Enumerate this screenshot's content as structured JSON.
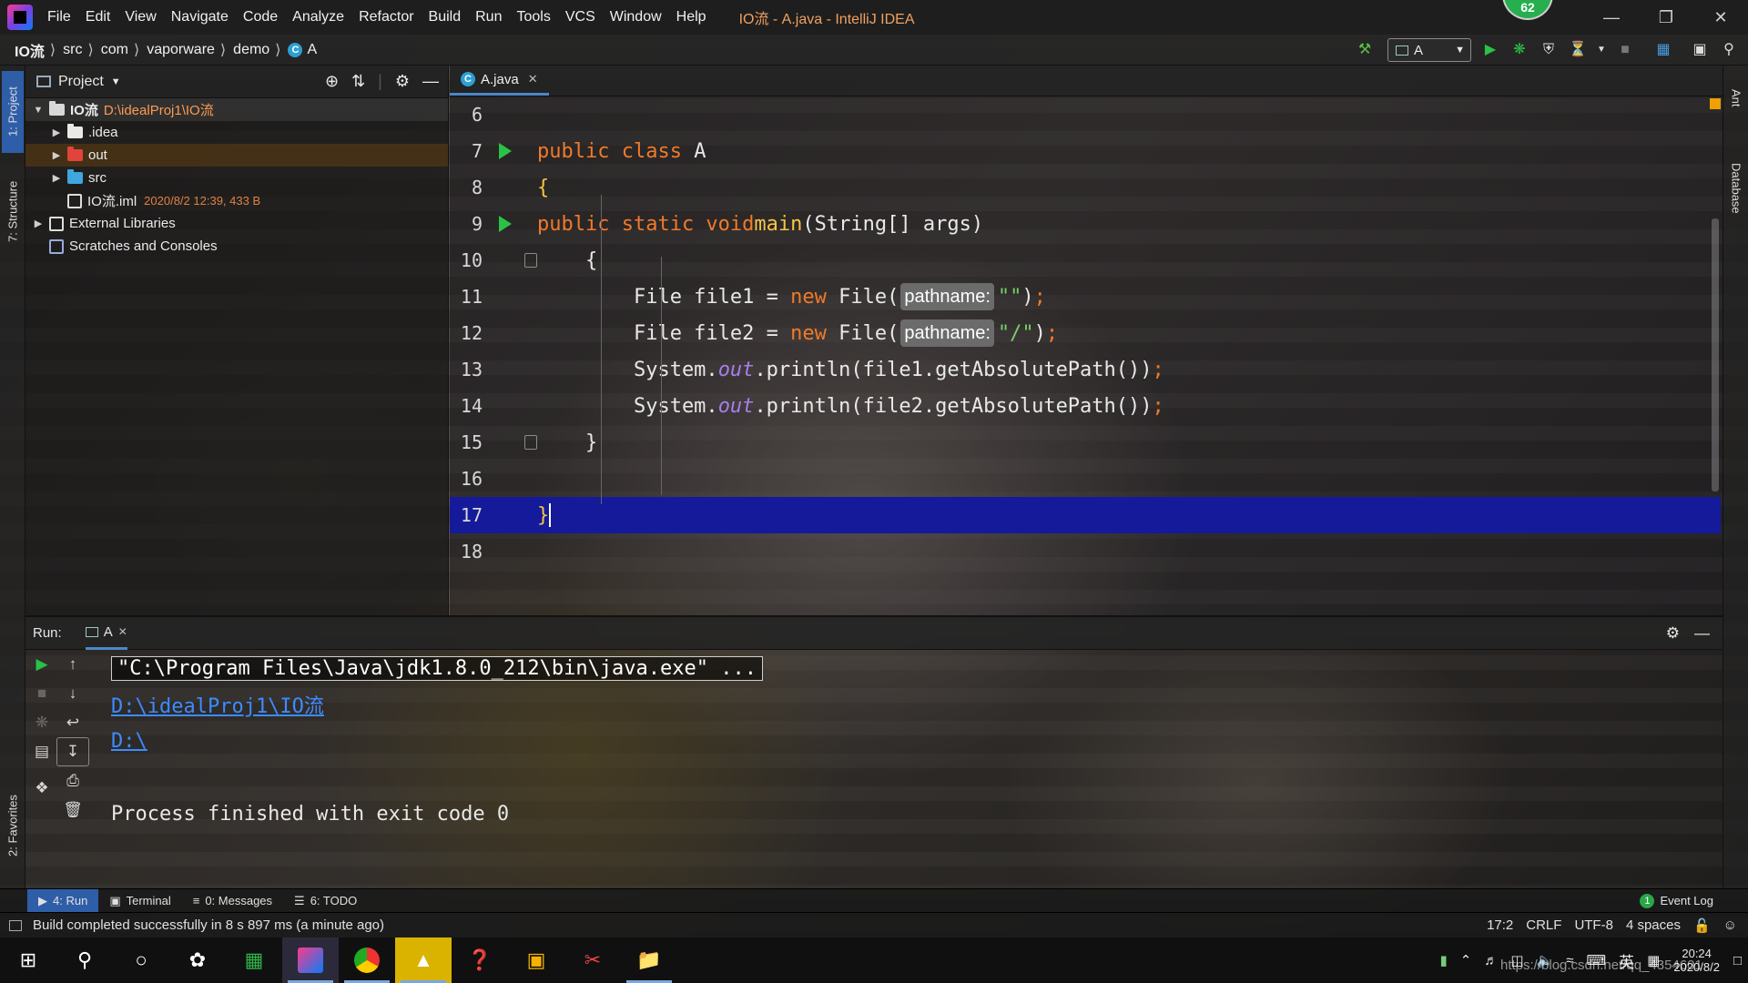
{
  "title_bar": {
    "menu": [
      "File",
      "Edit",
      "View",
      "Navigate",
      "Code",
      "Analyze",
      "Refactor",
      "Build",
      "Run",
      "Tools",
      "VCS",
      "Window",
      "Help"
    ],
    "window_title": "IO流 - A.java - IntelliJ IDEA",
    "notification_count": "62",
    "controls": [
      "minimize",
      "restore",
      "close"
    ]
  },
  "nav_bar": {
    "breadcrumbs": [
      "IO流",
      "src",
      "com",
      "vaporware",
      "demo",
      "A"
    ],
    "run_config": "A"
  },
  "left_stripe": {
    "tabs": [
      "1: Project",
      "7: Structure",
      "2: Favorites"
    ]
  },
  "right_stripe": {
    "tabs": [
      "Ant",
      "Database"
    ]
  },
  "project_panel": {
    "title": "Project",
    "tree": [
      {
        "label": "IO流",
        "meta": "D:\\idealProj1\\IO流",
        "icon": "module-folder-icon",
        "indent": 0,
        "expanded": true,
        "selected": true
      },
      {
        "label": ".idea",
        "meta": "",
        "icon": "folder-icon",
        "indent": 1,
        "expanded": false
      },
      {
        "label": "out",
        "meta": "",
        "icon": "excluded-folder-icon",
        "indent": 1,
        "expanded": false,
        "selected": true
      },
      {
        "label": "src",
        "meta": "",
        "icon": "source-folder-icon",
        "indent": 1,
        "expanded": false
      },
      {
        "label": "IO流.iml",
        "meta": "2020/8/2 12:39, 433 B",
        "icon": "iml-file-icon",
        "indent": 1
      },
      {
        "label": "External Libraries",
        "meta": "",
        "icon": "libraries-icon",
        "indent": 0,
        "expanded": false
      },
      {
        "label": "Scratches and Consoles",
        "meta": "",
        "icon": "scratches-icon",
        "indent": 0
      }
    ]
  },
  "editor": {
    "tab": "A.java",
    "lines": [
      {
        "n": "6",
        "html": ""
      },
      {
        "n": "7",
        "run": true,
        "html": "<span class=\"kw\">public class</span> A"
      },
      {
        "n": "8",
        "html": "<span class=\"fn\">{</span>"
      },
      {
        "n": "9",
        "run": true,
        "html": "    <span class=\"kw\">public static void</span> <span class=\"fn\">main</span>(String[] args)"
      },
      {
        "n": "10",
        "fold": true,
        "html": "    {"
      },
      {
        "n": "11",
        "html": "        File file1 = <span class=\"kw\">new</span> File(<span class=\"hint\">pathname:</span><span class=\"str\">\"\"</span>)<span class=\"semi\">;</span>"
      },
      {
        "n": "12",
        "html": "        File file2 = <span class=\"kw\">new</span> File(<span class=\"hint\">pathname:</span><span class=\"str\">\"/\"</span>)<span class=\"semi\">;</span>"
      },
      {
        "n": "13",
        "html": "        System.<span class=\"fld\">out</span>.println(file1.getAbsolutePath())<span class=\"semi\">;</span>"
      },
      {
        "n": "14",
        "html": "        System.<span class=\"fld\">out</span>.println(file2.getAbsolutePath())<span class=\"semi\">;</span>"
      },
      {
        "n": "15",
        "fold": true,
        "html": "    }"
      },
      {
        "n": "16",
        "html": ""
      },
      {
        "n": "17",
        "current": true,
        "html": "<span class=\"fn\">}</span>"
      },
      {
        "n": "18",
        "html": ""
      }
    ]
  },
  "run_panel": {
    "label": "Run:",
    "tab": "A",
    "console": [
      {
        "text": "\"C:\\Program Files\\Java\\jdk1.8.0_212\\bin\\java.exe\" ...",
        "kind": "cmd"
      },
      {
        "text": "D:\\idealProj1\\IO流",
        "kind": "link"
      },
      {
        "text": "D:\\",
        "kind": "link"
      },
      {
        "text": "",
        "kind": "plain"
      },
      {
        "text": "Process finished with exit code 0",
        "kind": "plain"
      }
    ]
  },
  "bottom_tabs": [
    {
      "label": "4: Run",
      "icon": "run-icon",
      "active": true
    },
    {
      "label": "Terminal",
      "icon": "terminal-icon"
    },
    {
      "label": "0: Messages",
      "icon": "messages-icon"
    },
    {
      "label": "6: TODO",
      "icon": "todo-icon"
    }
  ],
  "event_log": {
    "label": "Event Log",
    "count": "1"
  },
  "status_bar": {
    "message": "Build completed successfully in 8 s 897 ms (a minute ago)",
    "position": "17:2",
    "line_separator": "CRLF",
    "encoding": "UTF-8",
    "indent": "4 spaces"
  },
  "taskbar": {
    "time": "20:24",
    "date": "2020/8/2",
    "ime": "英",
    "watermark": "https://blog.csdn.net/qq_4354601"
  },
  "colors": {
    "keyword": "#f07a2a",
    "function": "#f5c542",
    "string": "#7bcf6a",
    "field": "#a77ee8",
    "current_line": "#141a9a",
    "link": "#3d8bff",
    "run_green": "#29c246",
    "active_tab": "#2f5ea8"
  }
}
